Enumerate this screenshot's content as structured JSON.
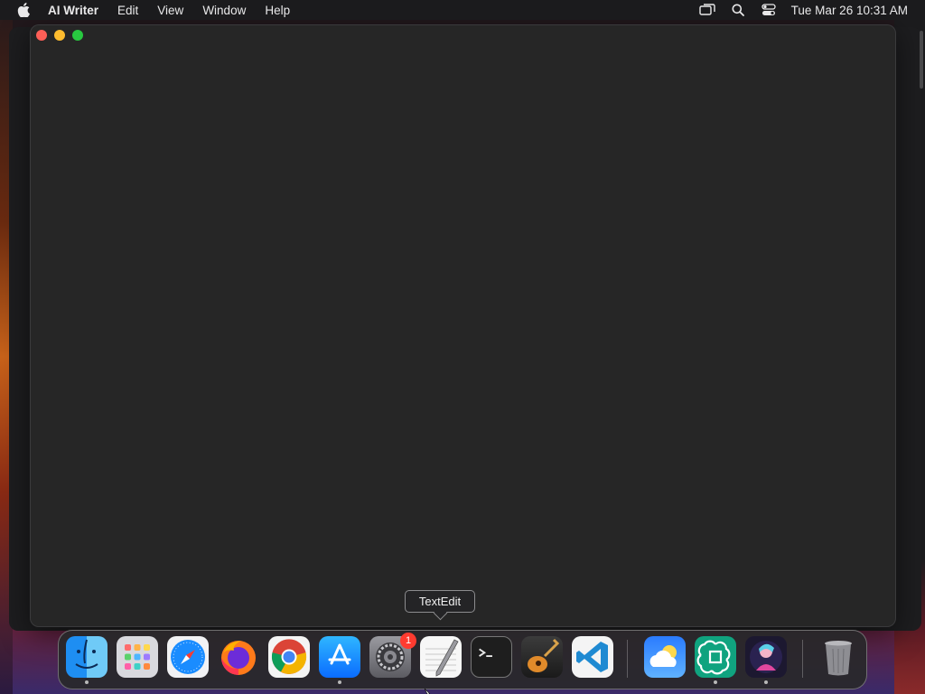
{
  "menubar": {
    "app_name": "AI Writer",
    "menus": [
      "Edit",
      "View",
      "Window",
      "Help"
    ],
    "clock": "Tue Mar 26  10:31 AM",
    "status_icons": [
      "screen-mirroring-icon",
      "spotlight-search-icon",
      "control-center-icon"
    ]
  },
  "window": {
    "controls": [
      "close",
      "minimize",
      "zoom"
    ],
    "colors": {
      "close": "#fe5f57",
      "minimize": "#febc2e",
      "zoom": "#28c840",
      "background": "#262626"
    }
  },
  "tooltip": {
    "text": "TextEdit"
  },
  "dock": {
    "items": [
      {
        "name": "Finder",
        "icon": "finder-icon",
        "running": true
      },
      {
        "name": "Launchpad",
        "icon": "launchpad-icon",
        "running": false
      },
      {
        "name": "Safari",
        "icon": "safari-icon",
        "running": false
      },
      {
        "name": "Firefox",
        "icon": "firefox-icon",
        "running": false
      },
      {
        "name": "Google Chrome",
        "icon": "chrome-icon",
        "running": false
      },
      {
        "name": "App Store",
        "icon": "app-store-icon",
        "running": true
      },
      {
        "name": "System Settings",
        "icon": "system-settings-icon",
        "running": false,
        "badge": "1"
      },
      {
        "name": "TextEdit",
        "icon": "textedit-icon",
        "running": false
      },
      {
        "name": "Terminal",
        "icon": "terminal-icon",
        "running": false
      },
      {
        "name": "GarageBand",
        "icon": "garageband-icon",
        "running": false
      },
      {
        "name": "Visual Studio Code",
        "icon": "vscode-icon",
        "running": false
      },
      {
        "name": "Weather",
        "icon": "weather-icon",
        "running": false
      },
      {
        "name": "ChatGPT",
        "icon": "chatgpt-icon",
        "running": true
      },
      {
        "name": "AI Writer",
        "icon": "ai-writer-icon",
        "running": true
      },
      {
        "name": "Trash",
        "icon": "trash-icon",
        "running": false
      }
    ]
  }
}
